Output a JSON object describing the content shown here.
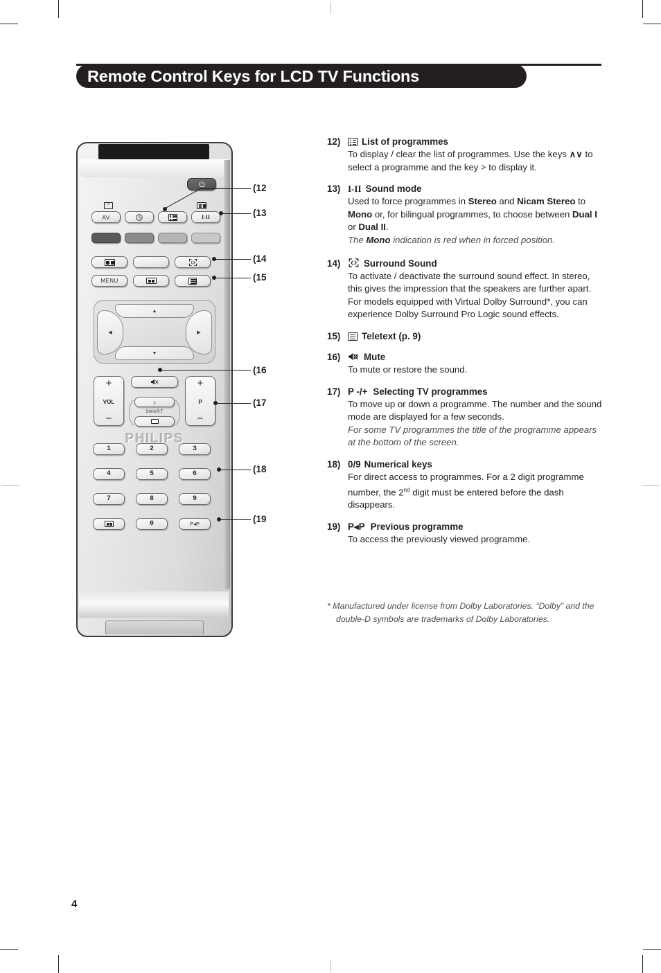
{
  "document": {
    "title": "Remote Control Keys for LCD TV Functions",
    "page_number": "4"
  },
  "entries": [
    {
      "num": "12)",
      "icon": "list-of-programmes-icon",
      "heading": "List of programmes",
      "body_html": "To display / clear the list of programmes. Use the keys <span class=\"mono-sym\">&#8743;&#8744;</span> to select a programme and the key <span class=\"mono-sym\">&gt;</span> to display it.",
      "body_text": "To display / clear the list of programmes. Use the keys ∧∨ to select a programme and the key > to display it."
    },
    {
      "num": "13)",
      "icon": "sound-mode-icon",
      "icon_text": "I-II",
      "heading": "Sound mode",
      "body_html": "Used to force programmes in <b>Stereo</b> and <b>Nicam Stereo</b> to <b>Mono</b> or, for bilingual programmes, to choose between <b>Dual I</b> or <b>Dual II</b>.<br><span class=\"ital\">The <b>Mono</b> indication is red when in forced position.</span>",
      "body_text": "Used to force programmes in Stereo and Nicam Stereo to Mono or, for bilingual programmes, to choose between Dual I or Dual II. The Mono indication is red when in forced position."
    },
    {
      "num": "14)",
      "icon": "surround-sound-icon",
      "heading": "Surround Sound",
      "body_html": "To activate / deactivate the surround sound effect. In stereo, this gives the impression that the speakers are further apart. For models equipped with Virtual Dolby Surround*, you can experience Dolby Surround Pro Logic sound effects.",
      "body_text": "To activate / deactivate the surround sound effect. In stereo, this gives the impression that the speakers are further apart. For models equipped with Virtual Dolby Surround*, you can experience Dolby Surround Pro Logic sound effects."
    },
    {
      "num": "15)",
      "icon": "teletext-icon",
      "heading": "Teletext (p. 9)",
      "body_html": "",
      "body_text": ""
    },
    {
      "num": "16)",
      "icon": "mute-icon",
      "heading": "Mute",
      "body_html": "To mute or restore the sound.",
      "body_text": "To mute or restore the sound."
    },
    {
      "num": "17)",
      "icon": "p-minus-plus-icon",
      "icon_text": "P -/+",
      "heading": "Selecting TV programmes",
      "body_html": "To move up or down a programme. The number and the sound mode are displayed for a few seconds.<br><span class=\"ital\">For some TV programmes the title of the programme appears at the bottom of the screen.</span>",
      "body_text": "To move up or down a programme. The number and the sound mode are displayed for a few seconds. For some TV programmes the title of the programme appears at the bottom of the screen."
    },
    {
      "num": "18)",
      "icon": "",
      "icon_text": "0/9",
      "heading": "Numerical keys",
      "body_html": "For direct access to programmes. For a 2 digit programme number, the 2<sup class=\"ord\">nd</sup> digit must be entered before the dash disappears.",
      "body_text": "For direct access to programmes. For a 2 digit programme number, the 2nd digit must be entered before the dash disappears."
    },
    {
      "num": "19)",
      "icon": "previous-programme-icon",
      "icon_text": "P◂P",
      "heading": "Previous programme",
      "body_html": "To access the previously viewed programme.",
      "body_text": "To access the previously viewed programme."
    }
  ],
  "footnote": {
    "marker": "*",
    "text": "Manufactured under license from Dolby Laboratories. “Dolby” and the double-D symbols are trademarks of Dolby Laboratories."
  },
  "remote": {
    "brand": "PHILIPS",
    "keys": {
      "power": "⏻",
      "av": "AV",
      "menu": "MENU",
      "smart": "SMART",
      "pip": "P◂P",
      "numbers": [
        "1",
        "2",
        "3",
        "4",
        "5",
        "6",
        "7",
        "8",
        "9",
        "0"
      ],
      "vol": "VOL",
      "p": "P",
      "plus": "+",
      "minus": "−"
    },
    "color_keys": [
      "#595959",
      "#8c8c8c",
      "#b5b5b5",
      "#c9c9c9"
    ]
  },
  "callouts": [
    {
      "label": "(12",
      "target": "list-of-programmes-key"
    },
    {
      "label": "(13",
      "target": "sound-mode-key"
    },
    {
      "label": "(14",
      "target": "surround-sound-key"
    },
    {
      "label": "(15",
      "target": "teletext-key"
    },
    {
      "label": "(16",
      "target": "mute-key"
    },
    {
      "label": "(17",
      "target": "p-rocker-key"
    },
    {
      "label": "(18",
      "target": "numeric-keys"
    },
    {
      "label": "(19",
      "target": "previous-programme-key"
    }
  ],
  "colors": {
    "ink": "#231f20",
    "title_bar_bg": "#231f20",
    "title_text": "#ffffff",
    "italic_note": "#4a4a4a",
    "page_bg": "#ffffff"
  }
}
